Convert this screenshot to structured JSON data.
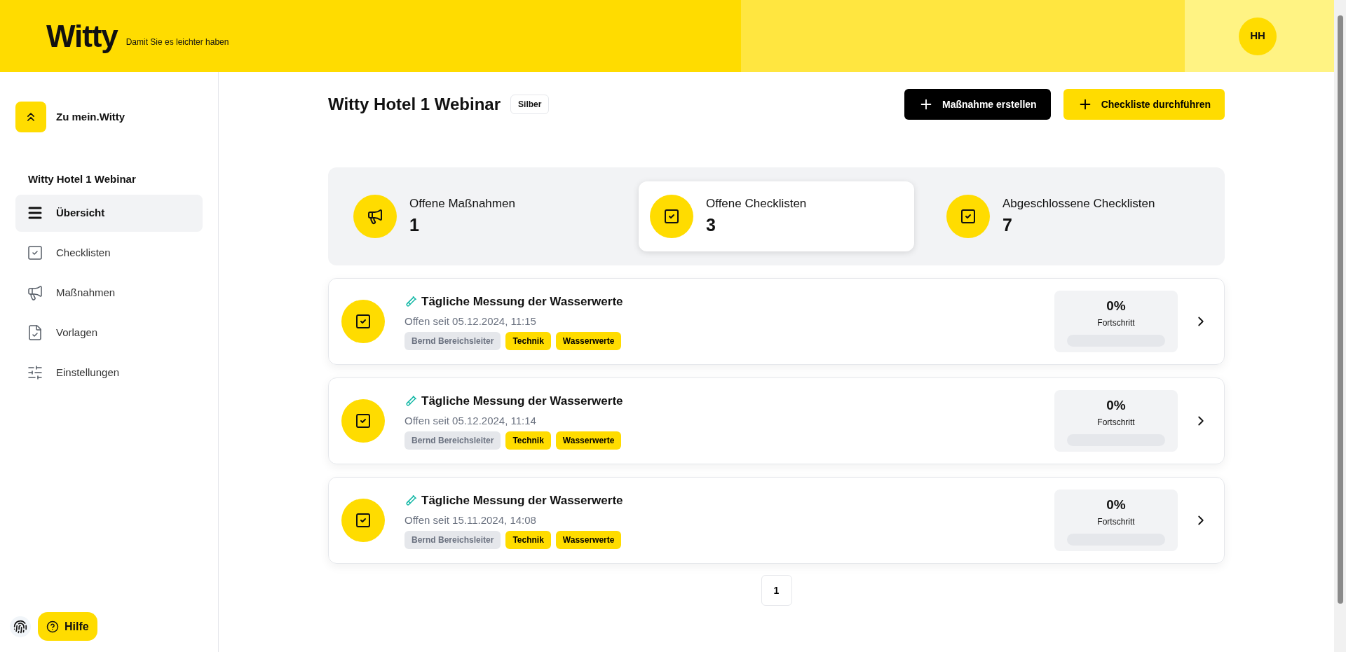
{
  "header": {
    "logo": "Witty",
    "tagline": "Damit Sie es leichter haben",
    "avatar": "HH"
  },
  "sidebar": {
    "back": "Zu mein.Witty",
    "section": "Witty Hotel 1 Webinar",
    "items": [
      {
        "label": "Übersicht",
        "selected": true
      },
      {
        "label": "Checklisten",
        "selected": false
      },
      {
        "label": "Maßnahmen",
        "selected": false
      },
      {
        "label": "Vorlagen",
        "selected": false
      },
      {
        "label": "Einstellungen",
        "selected": false
      }
    ],
    "help": "Hilfe"
  },
  "page": {
    "title": "Witty Hotel 1 Webinar",
    "badge": "Silber",
    "buttons": [
      {
        "label": "Maßnahme erstellen",
        "kind": "dark"
      },
      {
        "label": "Checkliste durchführen",
        "kind": "yellow"
      }
    ]
  },
  "stats": [
    {
      "label": "Offene Maßnahmen",
      "value": "1",
      "selected": false
    },
    {
      "label": "Offene Checklisten",
      "value": "3",
      "selected": true
    },
    {
      "label": "Abgeschlossene Checklisten",
      "value": "7",
      "selected": false
    }
  ],
  "checklists": [
    {
      "title": "Tägliche Messung der Wasserwerte",
      "subtitle": "Offen seit 05.12.2024, 11:15",
      "tags": [
        {
          "label": "Bernd Bereichsleiter",
          "kind": "person"
        },
        {
          "label": "Technik",
          "kind": "tag"
        },
        {
          "label": "Wasserwerte",
          "kind": "tag"
        }
      ],
      "percent": "0%",
      "progress_label": "Fortschritt",
      "level": 0
    },
    {
      "title": "Tägliche Messung der Wasserwerte",
      "subtitle": "Offen seit 05.12.2024, 11:14",
      "tags": [
        {
          "label": "Bernd Bereichsleiter",
          "kind": "person"
        },
        {
          "label": "Technik",
          "kind": "tag"
        },
        {
          "label": "Wasserwerte",
          "kind": "tag"
        }
      ],
      "percent": "0%",
      "progress_label": "Fortschritt",
      "level": 0
    },
    {
      "title": "Tägliche Messung der Wasserwerte",
      "subtitle": "Offen seit 15.11.2024, 14:08",
      "tags": [
        {
          "label": "Bernd Bereichsleiter",
          "kind": "person"
        },
        {
          "label": "Technik",
          "kind": "tag"
        },
        {
          "label": "Wasserwerte",
          "kind": "tag"
        }
      ],
      "percent": "0%",
      "progress_label": "Fortschritt",
      "level": 0
    }
  ],
  "pagination": [
    {
      "label": "1",
      "selected": true
    }
  ]
}
